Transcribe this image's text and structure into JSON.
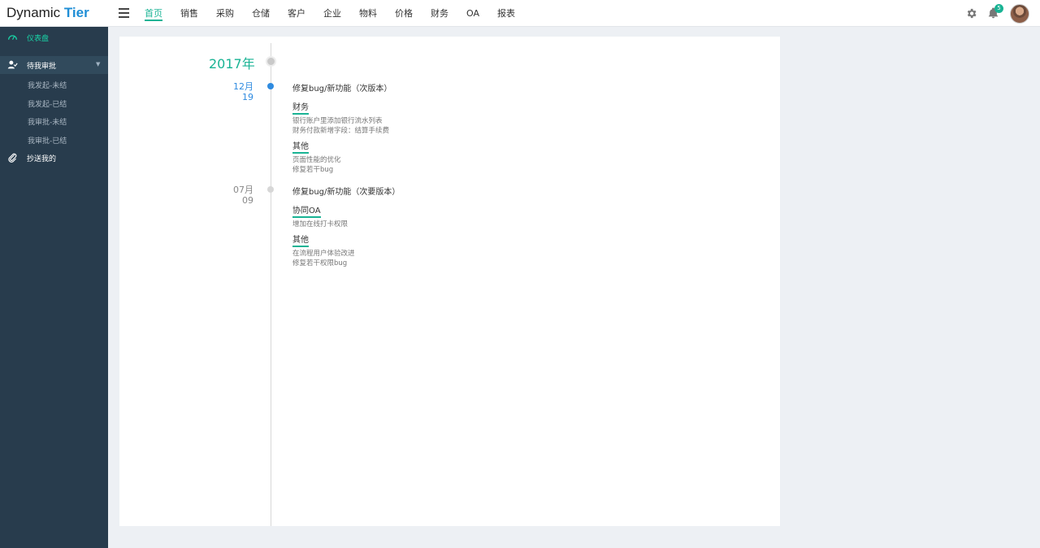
{
  "header": {
    "logo_part1": "Dynamic",
    "logo_part2": "Tier",
    "nav": [
      "首页",
      "销售",
      "采购",
      "仓储",
      "客户",
      "企业",
      "物料",
      "价格",
      "财务",
      "OA",
      "报表"
    ],
    "notification_count": "5"
  },
  "sidebar": {
    "dashboard": "仪表盘",
    "pending": "待我审批",
    "sub_items": [
      "我发起-未结",
      "我发起-已结",
      "我审批-未结",
      "我审批-已结"
    ],
    "cc": "抄送我的"
  },
  "timeline": {
    "year": "2017年",
    "entries": [
      {
        "month": "12月",
        "day": "19",
        "title": "修复bug/新功能（次版本）",
        "sections": [
          {
            "name": "财务",
            "lines": [
              "银行账户里添加银行流水列表",
              "财务付款新增字段：结算手续费"
            ]
          },
          {
            "name": "其他",
            "lines": [
              "页面性能的优化",
              "修复若干bug"
            ]
          }
        ]
      },
      {
        "month": "07月",
        "day": "09",
        "title": "修复bug/新功能（次要版本）",
        "sections": [
          {
            "name": "协同OA",
            "lines": [
              "增加在线打卡权限"
            ]
          },
          {
            "name": "其他",
            "lines": [
              "在流程用户体验改进",
              "修复若干权限bug"
            ]
          }
        ]
      }
    ]
  },
  "colors": {
    "accent": "#19b394",
    "sidebar_bg": "#283c4d",
    "date_active": "#2f8be0",
    "brand_blue": "#1f8ed6"
  }
}
